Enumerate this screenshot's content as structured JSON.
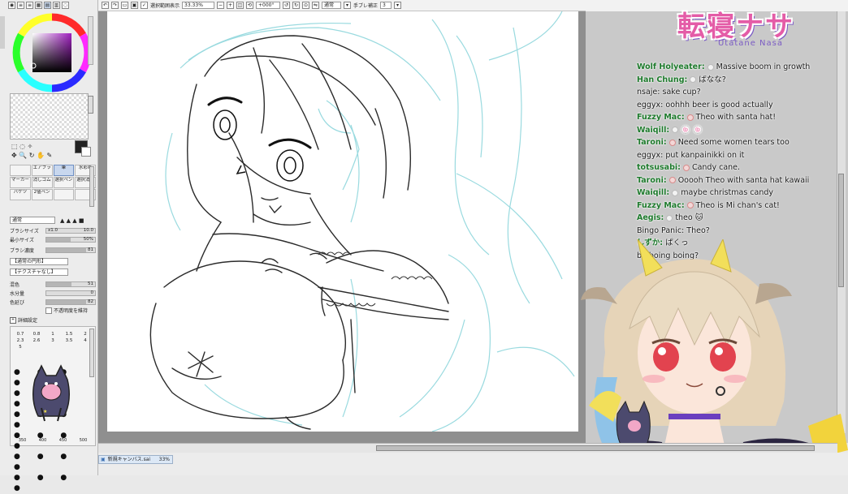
{
  "toolbar": {
    "checkbox_label": "選択範囲表示",
    "zoom": "33.33%",
    "angle": "+000°",
    "mode": "通常",
    "stabilizer_label": "手ブレ補正",
    "stabilizer_value": "3"
  },
  "tools": {
    "items": [
      "",
      "エアブラ",
      "筆",
      "水彩筆",
      "マーカー",
      "消しゴム",
      "選択ペン",
      "選択消し",
      "バケツ",
      "2値ペン",
      "",
      ""
    ],
    "selected_index": 2
  },
  "brush_props": {
    "blend_mode": "通常",
    "size_label": "ブラシサイズ",
    "size_multiplier": "x1.0",
    "size_value": "10.0",
    "min_size_label": "最小サイズ",
    "min_size_value": "50%",
    "density_label": "ブラシ濃度",
    "density_value": "81",
    "shape_select": "【通常の円形】",
    "texture_select": "【テクスチャなし】",
    "blend_label": "混色",
    "blend_value": "51",
    "water_label": "水分量",
    "water_value": "0",
    "persist_label": "色延び",
    "persist_value": "82",
    "opacity_keep_label": "不透明度を維持",
    "advanced_label": "詳細設定"
  },
  "brush_sizes": [
    "0.7",
    "0.8",
    "1",
    "1.5",
    "2",
    "2.3",
    "2.6",
    "3",
    "3.5",
    "4",
    "5",
    "",
    "",
    "",
    "",
    "",
    "",
    "",
    "",
    "",
    "",
    "",
    "",
    "",
    "",
    "",
    "",
    "",
    "",
    "350",
    "400",
    "450",
    "500"
  ],
  "status": {
    "doc_tab": "新規キャンバス.sai",
    "doc_zoom": "33%"
  },
  "logo": {
    "title": "転寝ナサ",
    "subtitle": "Utatane Nasa"
  },
  "chat": [
    {
      "user": "Wolf Holyeater:",
      "badge": "white",
      "message": "Massive boom in growth",
      "style": "member"
    },
    {
      "user": "Han Chung:",
      "badge": "white",
      "message": "ばなな?",
      "style": "member"
    },
    {
      "user": "nsaje:",
      "badge": "",
      "message": "sake cup?",
      "style": "plain"
    },
    {
      "user": "eggyx:",
      "badge": "",
      "message": "oohhh beer is good actually",
      "style": "plain"
    },
    {
      "user": "Fuzzy Mac:",
      "badge": "red",
      "message": "Theo with santa hat!",
      "style": "member"
    },
    {
      "user": "Waiqill:",
      "badge": "white",
      "message": "🍥 🍥",
      "style": "member"
    },
    {
      "user": "Taroni:",
      "badge": "red",
      "message": "Need some women tears too",
      "style": "member"
    },
    {
      "user": "eggyx:",
      "badge": "",
      "message": "put kanpainikki on it",
      "style": "plain"
    },
    {
      "user": "totsusabi:",
      "badge": "red",
      "message": "Candy cane.",
      "style": "member"
    },
    {
      "user": "Taroni:",
      "badge": "red",
      "message": "Ooooh Theo with santa hat kawaii",
      "style": "member"
    },
    {
      "user": "Waiqill:",
      "badge": "white",
      "message": "maybe christmas candy",
      "style": "member"
    },
    {
      "user": "Fuzzy Mac:",
      "badge": "red",
      "message": "Theo is Mi chan's cat!",
      "style": "member"
    },
    {
      "user": "Aegis:",
      "badge": "white",
      "message": "theo 🐱",
      "style": "member"
    },
    {
      "user": "Bingo Panic:",
      "badge": "",
      "message": "Theo?",
      "style": "plain"
    },
    {
      "user": "しずか:",
      "badge": "",
      "message": "ぱくっ",
      "style": "member"
    },
    {
      "user": "",
      "badge": "",
      "message": "be boing boing?",
      "style": "plain"
    }
  ],
  "colors": {
    "accent_green": "#1d7a2c",
    "sketch_line": "#8fd6dc",
    "panel_bg": "#ececec"
  }
}
